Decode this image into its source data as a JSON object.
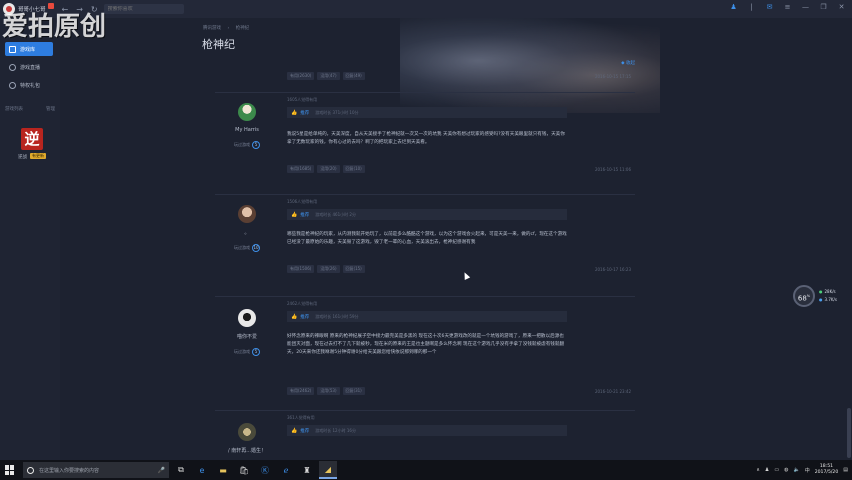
{
  "titlebar": {
    "app_name": "哥哥小七哥",
    "search_placeholder": "搜索你喜欢",
    "nav_back": "←",
    "nav_forward": "→",
    "nav_refresh": "↻"
  },
  "watermark": "爱拍原创",
  "sidebar": {
    "items": [
      {
        "label": "游戏库"
      },
      {
        "label": "游戏直播"
      },
      {
        "label": "特权礼包"
      }
    ],
    "section_label": "游戏列表",
    "section_action": "管理",
    "game_icon_char": "逆",
    "game_name": "逆战",
    "game_tag": "有更新"
  },
  "main": {
    "breadcrumb": [
      "腾讯游戏",
      "枪神纪"
    ],
    "page_title": "枪神纪",
    "collapse_label": "收起",
    "top_actions": [
      "有用(2630)",
      "没用(47)",
      "回复(49)"
    ],
    "top_timestamp": "2016-10-15 17:15",
    "reviews": [
      {
        "helpful": "1605人觉得有用",
        "username": "My Harris",
        "played_label": "玩过游戏",
        "played_count": "5",
        "rec_label": "推荐",
        "rec_meta": "游戏时长 371小时 10分",
        "text": "我说5星是给单纯的，天美深度，自从天美接手了枪神纪就一次又一次的坑我 天美你有想过玩家的感受吗?没有天美眼里就只有钱，天美你拿了无数玩家的钱，你有心过的去吗？啊了的把玩家上去烂到天美看。",
        "actions": [
          "有用(1685)",
          "没用(20)",
          "回复(10)"
        ],
        "timestamp": "2016-10-15 11:06"
      },
      {
        "helpful": "1506人觉得有用",
        "username": "。",
        "played_label": "玩过游戏",
        "played_count": "10",
        "rec_label": "推荐",
        "rec_meta": "游戏时长 461小时 2分",
        "text": "哪些我是枪神纪的玩家，从内测我就开始玩了，以前是多么酷酷这个游戏，以为这个游戏会火起来，可是天美一来，做的cf，现在这个游戏已经没了最原始的乐趣，天美毁了这游戏，毁了老一辈的心血，天美滚出去，枪神纪感谢有我",
        "actions": [
          "有用(1506)",
          "没用(26)",
          "回复(15)"
        ],
        "timestamp": "2016-10-17 16:23"
      },
      {
        "helpful": "2462人觉得有用",
        "username": "喵你不爱",
        "played_label": "玩过游戏",
        "played_count": "5",
        "rec_label": "推荐",
        "rec_meta": "游戏时长 161小时 59分",
        "text": "好怀念原来的辣眼啊 原来的枪神纪展子空中接力最完美是多黑的 现在这十次6天更游戏改的就是一个坑钱的游戏了，原来一把散以后源也能团灭对面，现在过去打不了几下就被秒，现在米的原来的王是也主题啊是多么怀念啊 现在这个游戏几乎没有手拿了没钱就被虐有钱就翻天，20天来你还我咻谢5分钟得谢0分给天美跟您给快依说那到哪的那一个",
        "actions": [
          "有用(2462)",
          "没用(53)",
          "回复(31)"
        ],
        "timestamp": "2016-10-21 23:42"
      },
      {
        "helpful": "361人觉得有用",
        "username": "/ 南轩再...婚生！",
        "played_label": "",
        "played_count": "",
        "rec_label": "推荐",
        "rec_meta": "游戏时长 12小时 16分",
        "text": "",
        "actions": [],
        "timestamp": ""
      }
    ]
  },
  "network": {
    "percent": "68",
    "percent_unit": "%",
    "up": "28K/s",
    "down": "3.7K/s"
  },
  "taskbar": {
    "search_placeholder": "在这里输入你要搜索的内容",
    "time": "18:51",
    "date": "2017/5/20",
    "ime": "中"
  }
}
